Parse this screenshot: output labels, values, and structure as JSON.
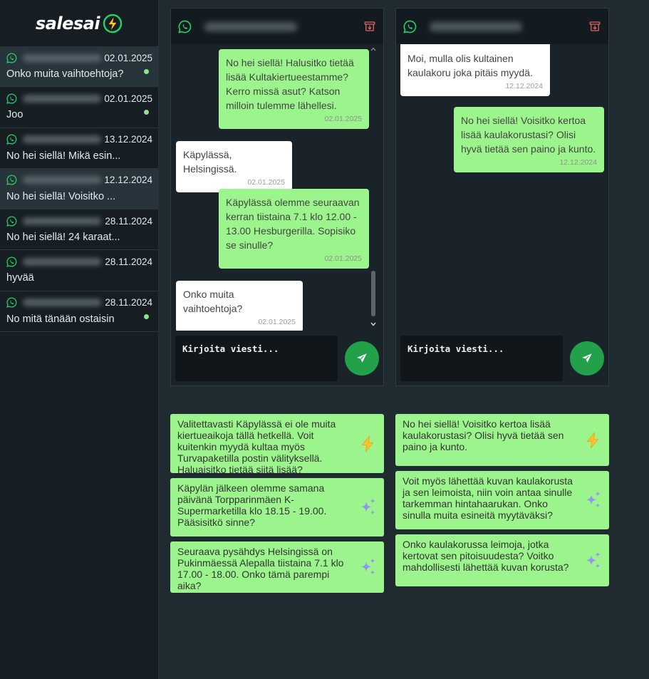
{
  "app": {
    "name": "salesai"
  },
  "colors": {
    "bubble_out": "#9cf58c",
    "bubble_in": "#ffffff",
    "send_button": "#22a04a",
    "unread_dot": "#8ce48c",
    "whatsapp": "#25d366"
  },
  "conversations": [
    {
      "date": "02.01.2025",
      "preview": "Onko muita vaihtoehtoja?",
      "unread": true,
      "active": true
    },
    {
      "date": "02.01.2025",
      "preview": "Joo",
      "unread": true,
      "active": false
    },
    {
      "date": "13.12.2024",
      "preview": "No hei siellä! Mikä esin...",
      "unread": false,
      "active": false
    },
    {
      "date": "12.12.2024",
      "preview": "No hei siellä! Voisitko ...",
      "unread": false,
      "active": true
    },
    {
      "date": "28.11.2024",
      "preview": "No hei siellä! 24 karaat...",
      "unread": false,
      "active": false
    },
    {
      "date": "28.11.2024",
      "preview": "hyvää",
      "unread": false,
      "active": false
    },
    {
      "date": "28.11.2024",
      "preview": "No mitä tänään ostaisin",
      "unread": true,
      "active": false
    }
  ],
  "chats": [
    {
      "composer_placeholder": "Kirjoita viesti...",
      "messages": [
        {
          "direction": "out",
          "text": "No hei siellä! Halusitko tietää lisää Kultakiertueestamme? Kerro missä asut? Katson milloin tulemme lähellesi.",
          "time": "02.01.2025"
        },
        {
          "direction": "in",
          "text": "Käpylässä, Helsingissä.",
          "time": "02.01.2025"
        },
        {
          "direction": "out",
          "text": "Käpylässä olemme seuraavan kerran tiistaina 7.1 klo 12.00 - 13.00 Hesburgerilla. Sopisiko se sinulle?",
          "time": "02.01.2025"
        },
        {
          "direction": "in",
          "text": "Onko muita vaihtoehtoja?",
          "time": "02.01.2025"
        }
      ],
      "suggestions": [
        {
          "text": "Valitettavasti Käpylässä ei ole muita kiertueaikoja tällä hetkellä. Voit kuitenkin myydä kultaa myös Turvapaketilla postin välityksellä. Haluaisitko tietää siitä lisää?",
          "icon": "lightning-icon"
        },
        {
          "text": "Käpylän jälkeen olemme samana päivänä Torpparinmäen K-Supermarketilla klo 18.15 - 19.00. Pääsisitkö sinne?",
          "icon": "sparkles-icon"
        },
        {
          "text": "Seuraava pysähdys Helsingissä on Pukinmäessä Alepalla tiistaina 7.1 klo 17.00 - 18.00. Onko tämä parempi aika?",
          "icon": "sparkles-icon"
        }
      ]
    },
    {
      "composer_placeholder": "Kirjoita viesti...",
      "messages": [
        {
          "direction": "in",
          "text": "Moi, mulla olis kultainen kaulakoru joka pitäis myydä.",
          "time": "12.12.2024"
        },
        {
          "direction": "out",
          "text": "No hei siellä! Voisitko kertoa lisää kaulakorustasi? Olisi hyvä tietää sen paino ja kunto.",
          "time": "12.12.2024"
        }
      ],
      "suggestions": [
        {
          "text": "No hei siellä! Voisitko kertoa lisää kaulakorustasi? Olisi hyvä tietää sen paino ja kunto.",
          "icon": "lightning-icon"
        },
        {
          "text": "Voit myös lähettää kuvan kaulakorusta ja sen leimoista, niin voin antaa sinulle tarkemman hintahaarukan. Onko sinulla muita esineitä myytäväksi?",
          "icon": "sparkles-icon"
        },
        {
          "text": "Onko kaulakorussa leimoja, jotka kertovat sen pitoisuudesta? Voitko mahdollisesti lähettää kuvan korusta?",
          "icon": "sparkles-icon"
        }
      ]
    }
  ]
}
